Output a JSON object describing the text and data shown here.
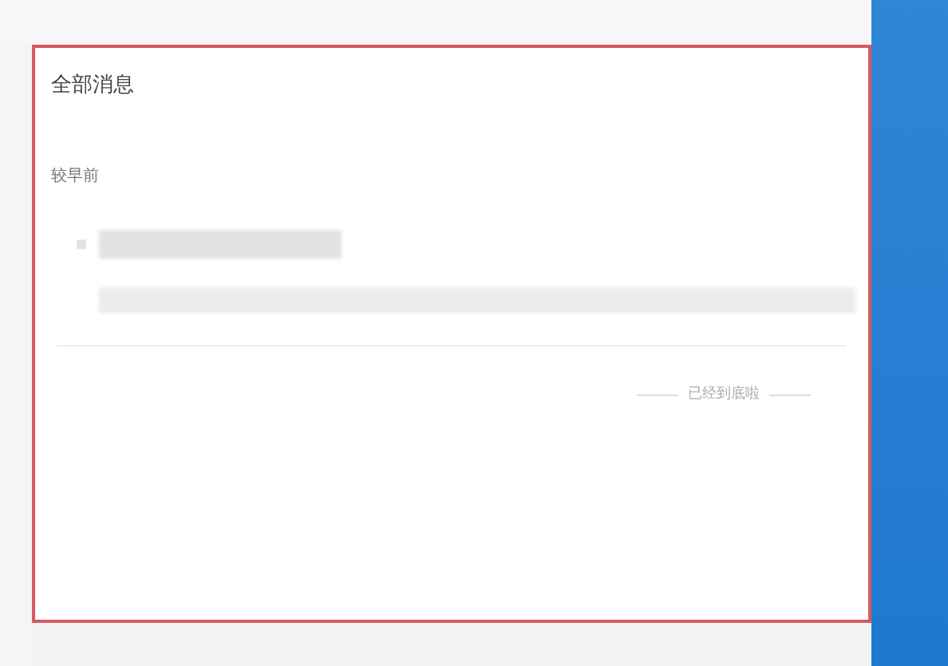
{
  "panel": {
    "title": "全部消息",
    "highlighted": true
  },
  "section": {
    "heading": "较早前"
  },
  "messages": [
    {
      "unread": true
    }
  ],
  "end_note": "已经到底啦"
}
